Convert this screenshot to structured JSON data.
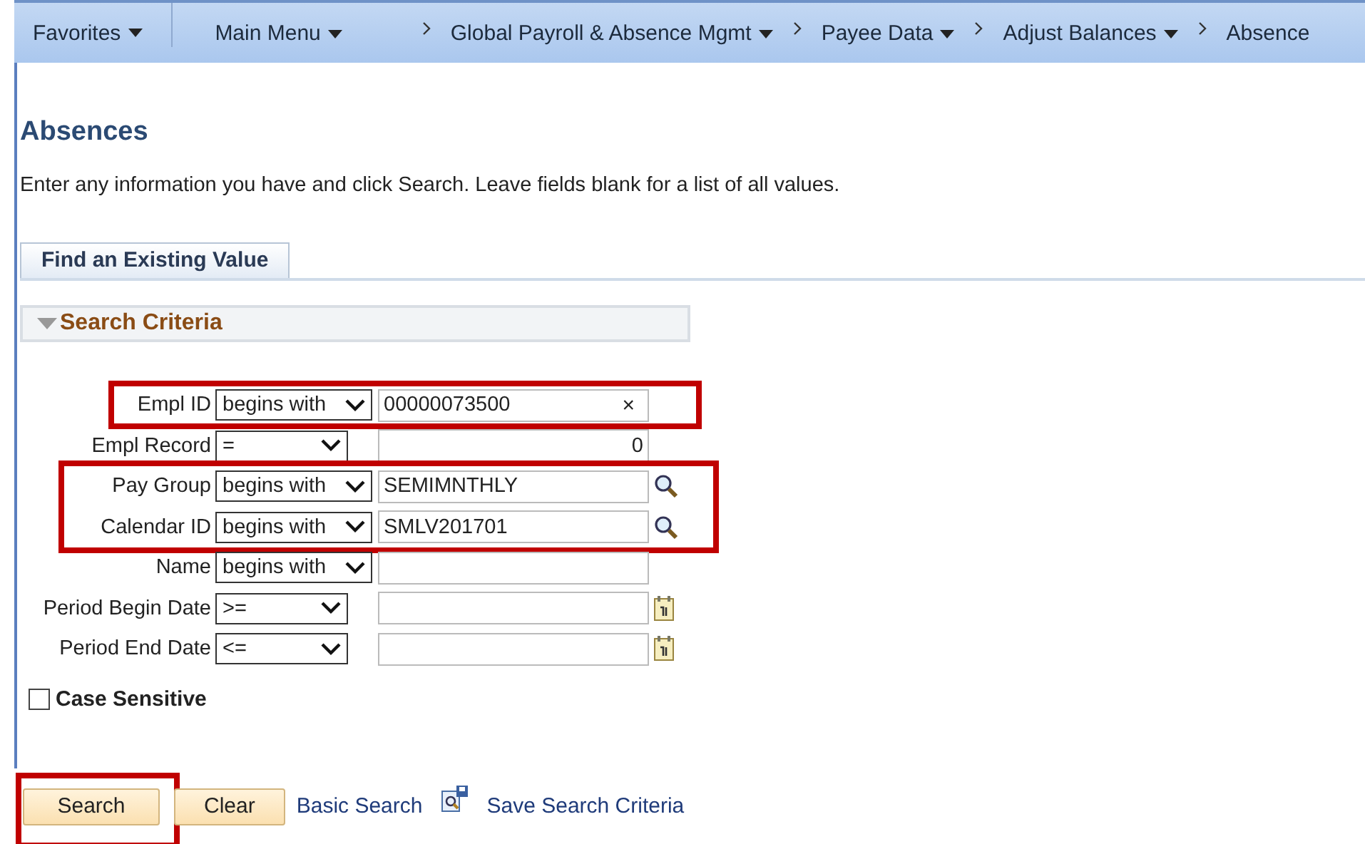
{
  "menu_bar": {
    "favorites": "Favorites",
    "main_menu": "Main Menu",
    "breadcrumbs": [
      {
        "label": "Global Payroll & Absence Mgmt",
        "dropdown": true
      },
      {
        "label": "Payee Data",
        "dropdown": true
      },
      {
        "label": "Adjust Balances",
        "dropdown": true
      },
      {
        "label": "Absence",
        "dropdown": false
      }
    ]
  },
  "title": "Absences",
  "instructions": "Enter any information you have and click Search. Leave fields blank for a list of all values.",
  "tabs": [
    {
      "label": "Find an Existing Value",
      "selected": true
    }
  ],
  "section": {
    "title": "Search Criteria",
    "expanded": true
  },
  "criteria_groups": [
    {
      "highlighted": true,
      "rows": [
        {
          "label": "Empl ID",
          "operator": "begins with",
          "value": "00000073500",
          "kind": "clear",
          "clear_symbol": "×"
        }
      ]
    },
    {
      "highlighted": false,
      "rows": [
        {
          "label": "Empl Record",
          "operator": "=",
          "value": "0",
          "kind": "number"
        }
      ]
    },
    {
      "highlighted": true,
      "rows": [
        {
          "label": "Pay Group",
          "operator": "begins with",
          "value": "SEMIMNTHLY",
          "kind": "lookup"
        },
        {
          "label": "Calendar ID",
          "operator": "begins with",
          "value": "SMLV201701",
          "kind": "lookup"
        }
      ]
    },
    {
      "highlighted": false,
      "rows": [
        {
          "label": "Name",
          "operator": "begins with",
          "kind": "text"
        },
        {
          "label": "Period Begin Date",
          "operator": ">=",
          "kind": "date"
        },
        {
          "label": "Period End Date",
          "operator": "<=",
          "kind": "date"
        }
      ]
    }
  ],
  "case_sensitive": {
    "label": "Case Sensitive",
    "checked": false
  },
  "buttons": [
    {
      "label": "Search",
      "highlighted": true
    },
    {
      "label": "Clear",
      "highlighted": false
    }
  ],
  "links": {
    "basic_search": "Basic Search",
    "save_search": "Save Search Criteria"
  }
}
